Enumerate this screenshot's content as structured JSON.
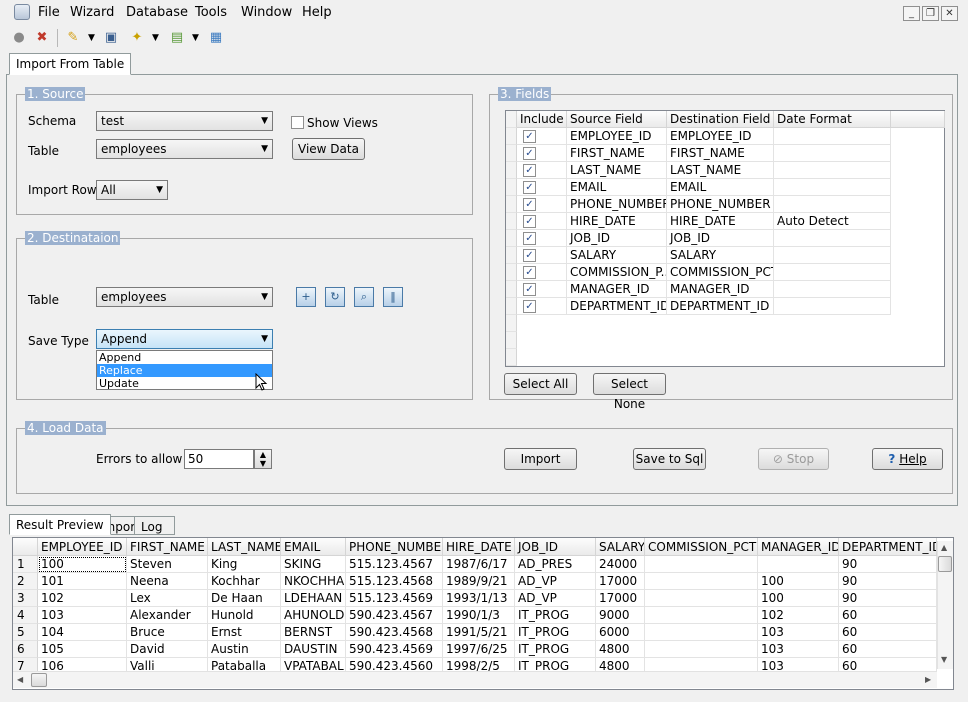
{
  "menu": {
    "items": [
      "File",
      "Wizard",
      "Database",
      "Tools",
      "Window",
      "Help"
    ]
  },
  "window_controls": {
    "minimize": "_",
    "restore": "❐",
    "close": "✕"
  },
  "toolbar_icons": [
    "connect-icon",
    "disconnect-icon",
    "wizard-icon",
    "preview-icon",
    "magic-icon",
    "window-icon",
    "grid-icon"
  ],
  "main_tab": "Import From Table",
  "source": {
    "title": "1. Source",
    "schema_label": "Schema",
    "schema_value": "test",
    "table_label": "Table",
    "table_value": "employees",
    "show_views_label": "Show Views",
    "view_data_button": "View Data",
    "import_rows_label": "Import Rows",
    "import_rows_value": "All"
  },
  "destination": {
    "title": "2. Destinataion",
    "table_label": "Table",
    "table_value": "employees",
    "save_type_label": "Save Type",
    "save_type_value": "Append",
    "save_type_options": [
      "Append",
      "Replace",
      "Update"
    ],
    "save_type_highlighted": "Replace"
  },
  "fields": {
    "title": "3. Fields",
    "columns": [
      "Include",
      "Source Field",
      "Destination Field",
      "Date Format"
    ],
    "rows": [
      {
        "include": true,
        "source": "EMPLOYEE_ID",
        "dest": "EMPLOYEE_ID",
        "fmt": ""
      },
      {
        "include": true,
        "source": "FIRST_NAME",
        "dest": "FIRST_NAME",
        "fmt": ""
      },
      {
        "include": true,
        "source": "LAST_NAME",
        "dest": "LAST_NAME",
        "fmt": ""
      },
      {
        "include": true,
        "source": "EMAIL",
        "dest": "EMAIL",
        "fmt": ""
      },
      {
        "include": true,
        "source": "PHONE_NUMBER",
        "dest": "PHONE_NUMBER",
        "fmt": ""
      },
      {
        "include": true,
        "source": "HIRE_DATE",
        "dest": "HIRE_DATE",
        "fmt": "Auto Detect"
      },
      {
        "include": true,
        "source": "JOB_ID",
        "dest": "JOB_ID",
        "fmt": ""
      },
      {
        "include": true,
        "source": "SALARY",
        "dest": "SALARY",
        "fmt": ""
      },
      {
        "include": true,
        "source": "COMMISSION_P...",
        "dest": "COMMISSION_PCT",
        "fmt": ""
      },
      {
        "include": true,
        "source": "MANAGER_ID",
        "dest": "MANAGER_ID",
        "fmt": ""
      },
      {
        "include": true,
        "source": "DEPARTMENT_ID",
        "dest": "DEPARTMENT_ID",
        "fmt": ""
      }
    ],
    "select_all_button": "Select All",
    "select_none_button": "Select None"
  },
  "load": {
    "title": "4. Load Data",
    "errors_label": "Errors to allow",
    "errors_value": "50",
    "import_button": "Import",
    "save_sql_button": "Save to Sql",
    "stop_button": "Stop",
    "help_button": "Help"
  },
  "bottom_tabs": [
    "Result Preview",
    "Import",
    "Log"
  ],
  "result": {
    "columns": [
      "EMPLOYEE_ID",
      "FIRST_NAME",
      "LAST_NAME",
      "EMAIL",
      "PHONE_NUMBER",
      "HIRE_DATE",
      "JOB_ID",
      "SALARY",
      "COMMISSION_PCT",
      "MANAGER_ID",
      "DEPARTMENT_ID"
    ],
    "rows": [
      {
        "n": "1",
        "cells": [
          "100",
          "Steven",
          "King",
          "SKING",
          "515.123.4567",
          "1987/6/17",
          "AD_PRES",
          "24000",
          "",
          "",
          "90"
        ]
      },
      {
        "n": "2",
        "cells": [
          "101",
          "Neena",
          "Kochhar",
          "NKOCHHAF",
          "515.123.4568",
          "1989/9/21",
          "AD_VP",
          "17000",
          "",
          "100",
          "90"
        ]
      },
      {
        "n": "3",
        "cells": [
          "102",
          "Lex",
          "De Haan",
          "LDEHAAN",
          "515.123.4569",
          "1993/1/13",
          "AD_VP",
          "17000",
          "",
          "100",
          "90"
        ]
      },
      {
        "n": "4",
        "cells": [
          "103",
          "Alexander",
          "Hunold",
          "AHUNOLD",
          "590.423.4567",
          "1990/1/3",
          "IT_PROG",
          "9000",
          "",
          "102",
          "60"
        ]
      },
      {
        "n": "5",
        "cells": [
          "104",
          "Bruce",
          "Ernst",
          "BERNST",
          "590.423.4568",
          "1991/5/21",
          "IT_PROG",
          "6000",
          "",
          "103",
          "60"
        ]
      },
      {
        "n": "6",
        "cells": [
          "105",
          "David",
          "Austin",
          "DAUSTIN",
          "590.423.4569",
          "1997/6/25",
          "IT_PROG",
          "4800",
          "",
          "103",
          "60"
        ]
      },
      {
        "n": "7",
        "cells": [
          "106",
          "Valli",
          "Pataballa",
          "VPATABAL",
          "590.423.4560",
          "1998/2/5",
          "IT_PROG",
          "4800",
          "",
          "103",
          "60"
        ]
      }
    ]
  }
}
